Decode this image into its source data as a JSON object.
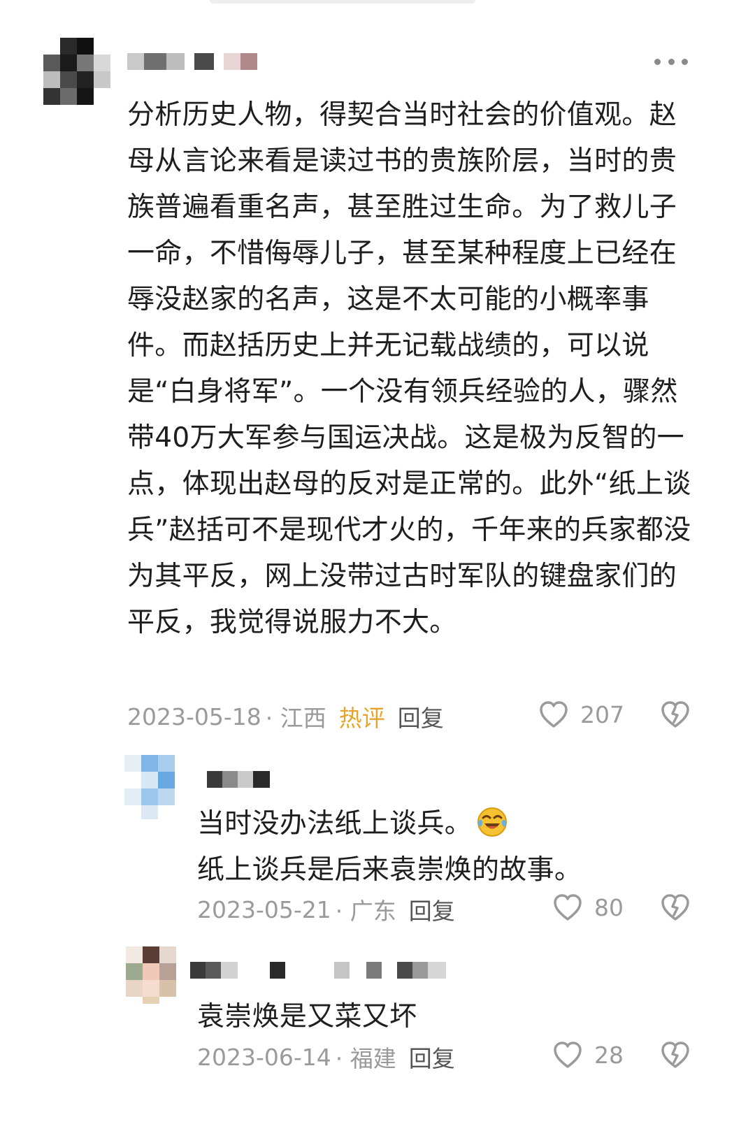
{
  "comments": [
    {
      "text": "分析历史人物，得契合当时社会的价值观。赵母从言论来看是读过书的贵族阶层，当时的贵族普遍看重名声，甚至胜过生命。为了救儿子一命，不惜侮辱儿子，甚至某种程度上已经在辱没赵家的名声，这是不太可能的小概率事件。而赵括历史上并无记载战绩的，可以说是“白身将军”。一个没有领兵经验的人，骤然带40万大军参与国运决战。这是极为反智的一点，体现出赵母的反对是正常的。此外“纸上谈兵”赵括可不是现代才火的，千年来的兵家都没为其平反，网上没带过古时军队的键盘家们的平反，我觉得说服力不大。",
      "date": "2023-05-18",
      "location": "· 江西",
      "badge": "热评",
      "reply_label": "回复",
      "likes": "207"
    },
    {
      "line1": "当时没办法纸上谈兵。",
      "line2": "纸上谈兵是后来袁崇焕的故事。",
      "emoji_icon": "laughing-crying-emoji",
      "date": "2023-05-21",
      "location": "· 广东",
      "reply_label": "回复",
      "likes": "80"
    },
    {
      "text": "袁崇焕是又菜又坏",
      "date": "2023-06-14",
      "location": "· 福建",
      "reply_label": "回复",
      "likes": "28"
    }
  ],
  "icons": {
    "more": "more-dots-icon",
    "like": "heart-icon",
    "dislike": "broken-heart-icon"
  },
  "colors": {
    "badge": "#e6a52a",
    "meta": "#9a9a9a",
    "text": "#1e1e1e"
  }
}
